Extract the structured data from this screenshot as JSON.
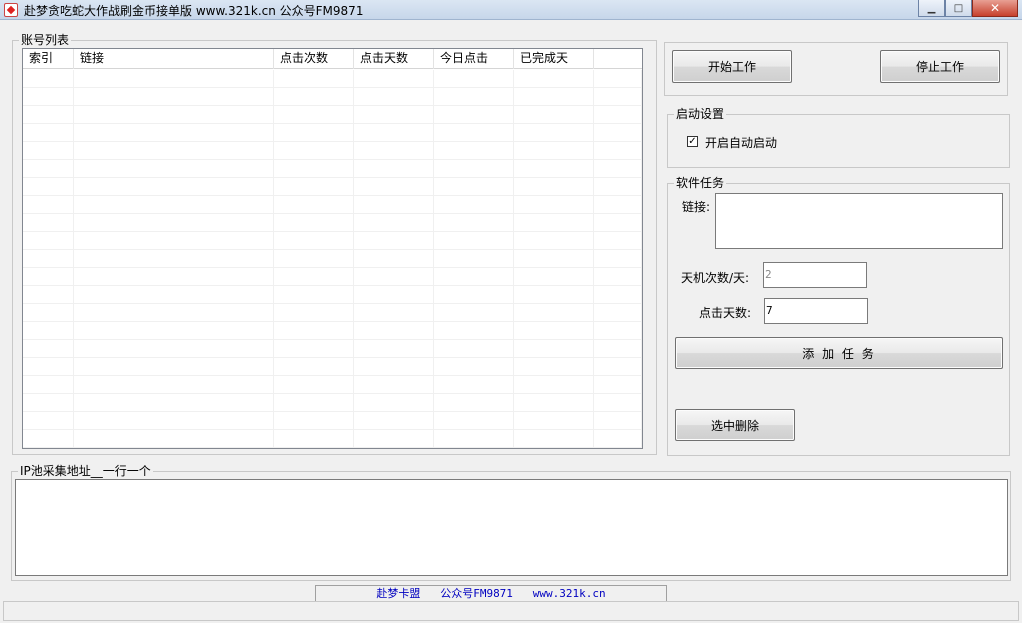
{
  "window": {
    "title": "赴梦贪吃蛇大作战刷金币接单版  www.321k.cn   公众号FM9871",
    "buttons": {
      "minimize": "▁",
      "maximize": "□",
      "close": "✕"
    }
  },
  "account_list": {
    "group_label": "账号列表",
    "columns": [
      "索引",
      "链接",
      "点击次数",
      "点击天数",
      "今日点击",
      "已完成天"
    ],
    "rows": []
  },
  "controls": {
    "start_button": "开始工作",
    "stop_button": "停止工作"
  },
  "startup_settings": {
    "group_label": "启动设置",
    "auto_start_label": "开启自动启动",
    "auto_start_checked": true,
    "check_mark": "✓"
  },
  "software_task": {
    "group_label": "软件任务",
    "link_label": "链接:",
    "link_value": "",
    "daily_clicks_label": "天机次数/天:",
    "daily_clicks_value": "2",
    "click_days_label": "点击天数:",
    "click_days_value": "7",
    "add_button": "添 加 任 务",
    "delete_button": "选中删除"
  },
  "ip_pool": {
    "group_label": "IP池采集地址__一行一个",
    "value": ""
  },
  "status": {
    "text": "赴梦卡盟   公众号FM9871   www.321k.cn"
  }
}
